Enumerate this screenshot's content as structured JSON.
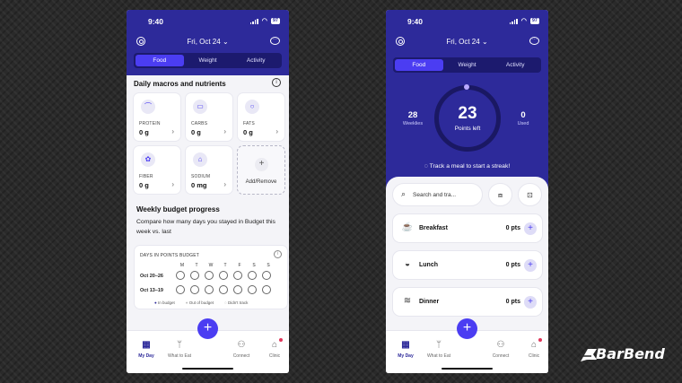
{
  "status_bar": {
    "time": "9:40",
    "battery": "97"
  },
  "header": {
    "date": "Fri, Oct 24",
    "tabs": [
      "Food",
      "Weight",
      "Activity"
    ]
  },
  "left": {
    "section_title": "Daily macros and nutrients",
    "macros": [
      {
        "label": "PROTEIN",
        "value": "0 g",
        "icon": "drumstick-icon"
      },
      {
        "label": "CARBS",
        "value": "0 g",
        "icon": "bread-icon"
      },
      {
        "label": "FATS",
        "value": "0 g",
        "icon": "drop-icon"
      },
      {
        "label": "FIBER",
        "value": "0 g",
        "icon": "broccoli-icon"
      },
      {
        "label": "SODIUM",
        "value": "0 mg",
        "icon": "salt-icon"
      }
    ],
    "add_remove": "Add/Remove",
    "weekly_title": "Weekly budget progress",
    "weekly_desc": "Compare how many days you stayed in Budget this week vs. last",
    "budget": {
      "title": "DAYS IN POINTS BUDGET",
      "days": [
        "M",
        "T",
        "W",
        "T",
        "F",
        "S",
        "S"
      ],
      "rows": [
        "Oct 20–26",
        "Oct 13–19"
      ],
      "legend": [
        "In budget",
        "Out of budget",
        "Didn't track"
      ]
    }
  },
  "right": {
    "weeklies_value": "28",
    "weeklies_label": "Weeklies",
    "points_value": "23",
    "points_label": "Points left",
    "used_value": "0",
    "used_label": "Used",
    "streak_text": "Track a meal to start a streak!",
    "search_placeholder": "Search and tra...",
    "meals": [
      {
        "name": "Breakfast",
        "points": "0 pts"
      },
      {
        "name": "Lunch",
        "points": "0 pts"
      },
      {
        "name": "Dinner",
        "points": "0 pts"
      }
    ]
  },
  "bottom_nav": [
    "My Day",
    "What to Eat",
    "Connect",
    "Clinic"
  ],
  "brand": {
    "name": "BarBend"
  },
  "colors": {
    "primary": "#2d2a9a",
    "accent": "#4b3df2",
    "background": "#2a2a2a"
  }
}
